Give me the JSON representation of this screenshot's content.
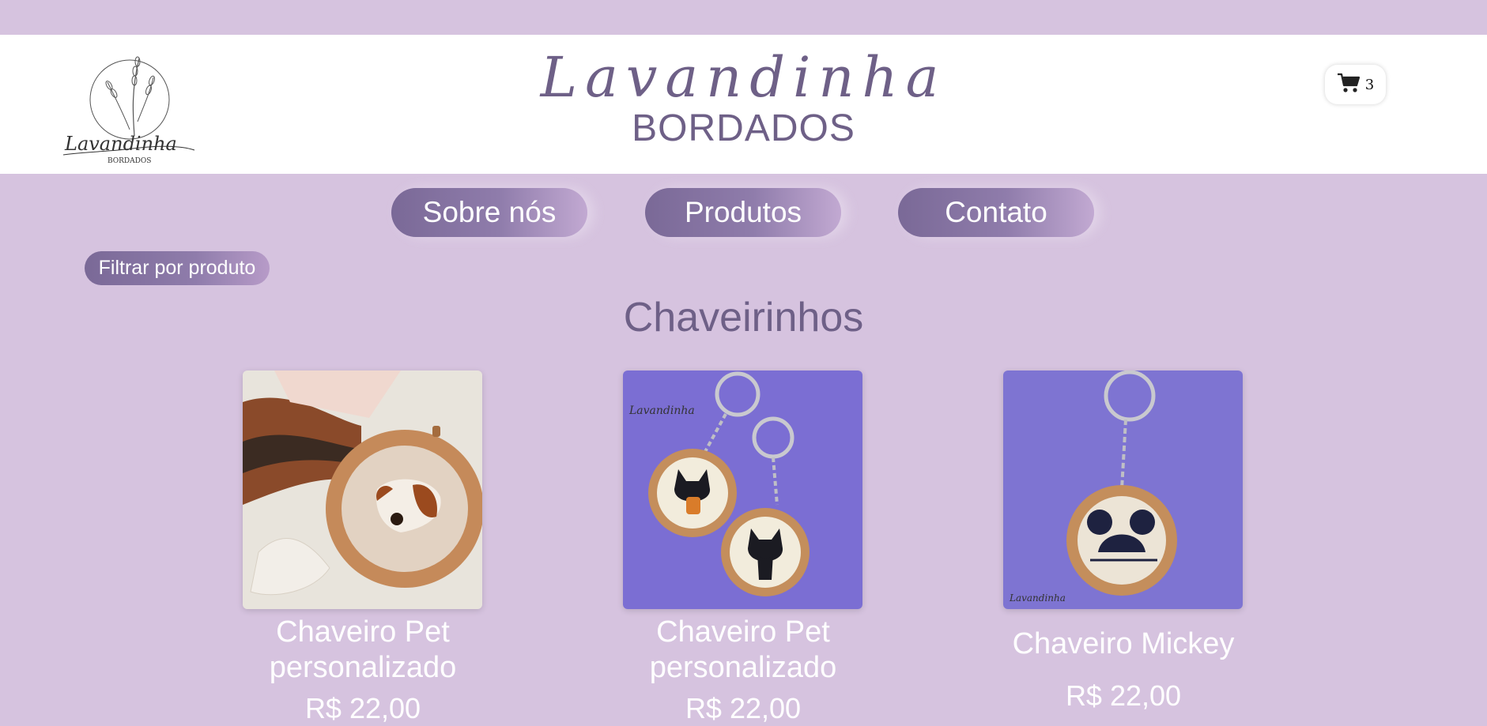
{
  "header": {
    "brand_script": "Lavandinha",
    "brand_sub": "BORDADOS",
    "logo_icon": "lavender-logo-icon",
    "cart": {
      "icon": "cart-icon",
      "count": "3"
    }
  },
  "nav": {
    "items": [
      {
        "label": "Sobre nós"
      },
      {
        "label": "Produtos"
      },
      {
        "label": "Contato"
      }
    ]
  },
  "filter": {
    "label": "Filtrar por produto"
  },
  "section": {
    "title": "Chaveirinhos"
  },
  "products": [
    {
      "name": "Chaveiro Pet personalizado",
      "price": "R$ 22,00"
    },
    {
      "name": "Chaveiro Pet personalizado",
      "price": "R$ 22,00"
    },
    {
      "name": "Chaveiro Mickey",
      "price": "R$ 22,00"
    }
  ],
  "colors": {
    "background": "#d6c3df",
    "header": "#ffffff",
    "accent": "#6e6087",
    "button_start": "#7a6997",
    "button_end": "#c2a9d2"
  }
}
